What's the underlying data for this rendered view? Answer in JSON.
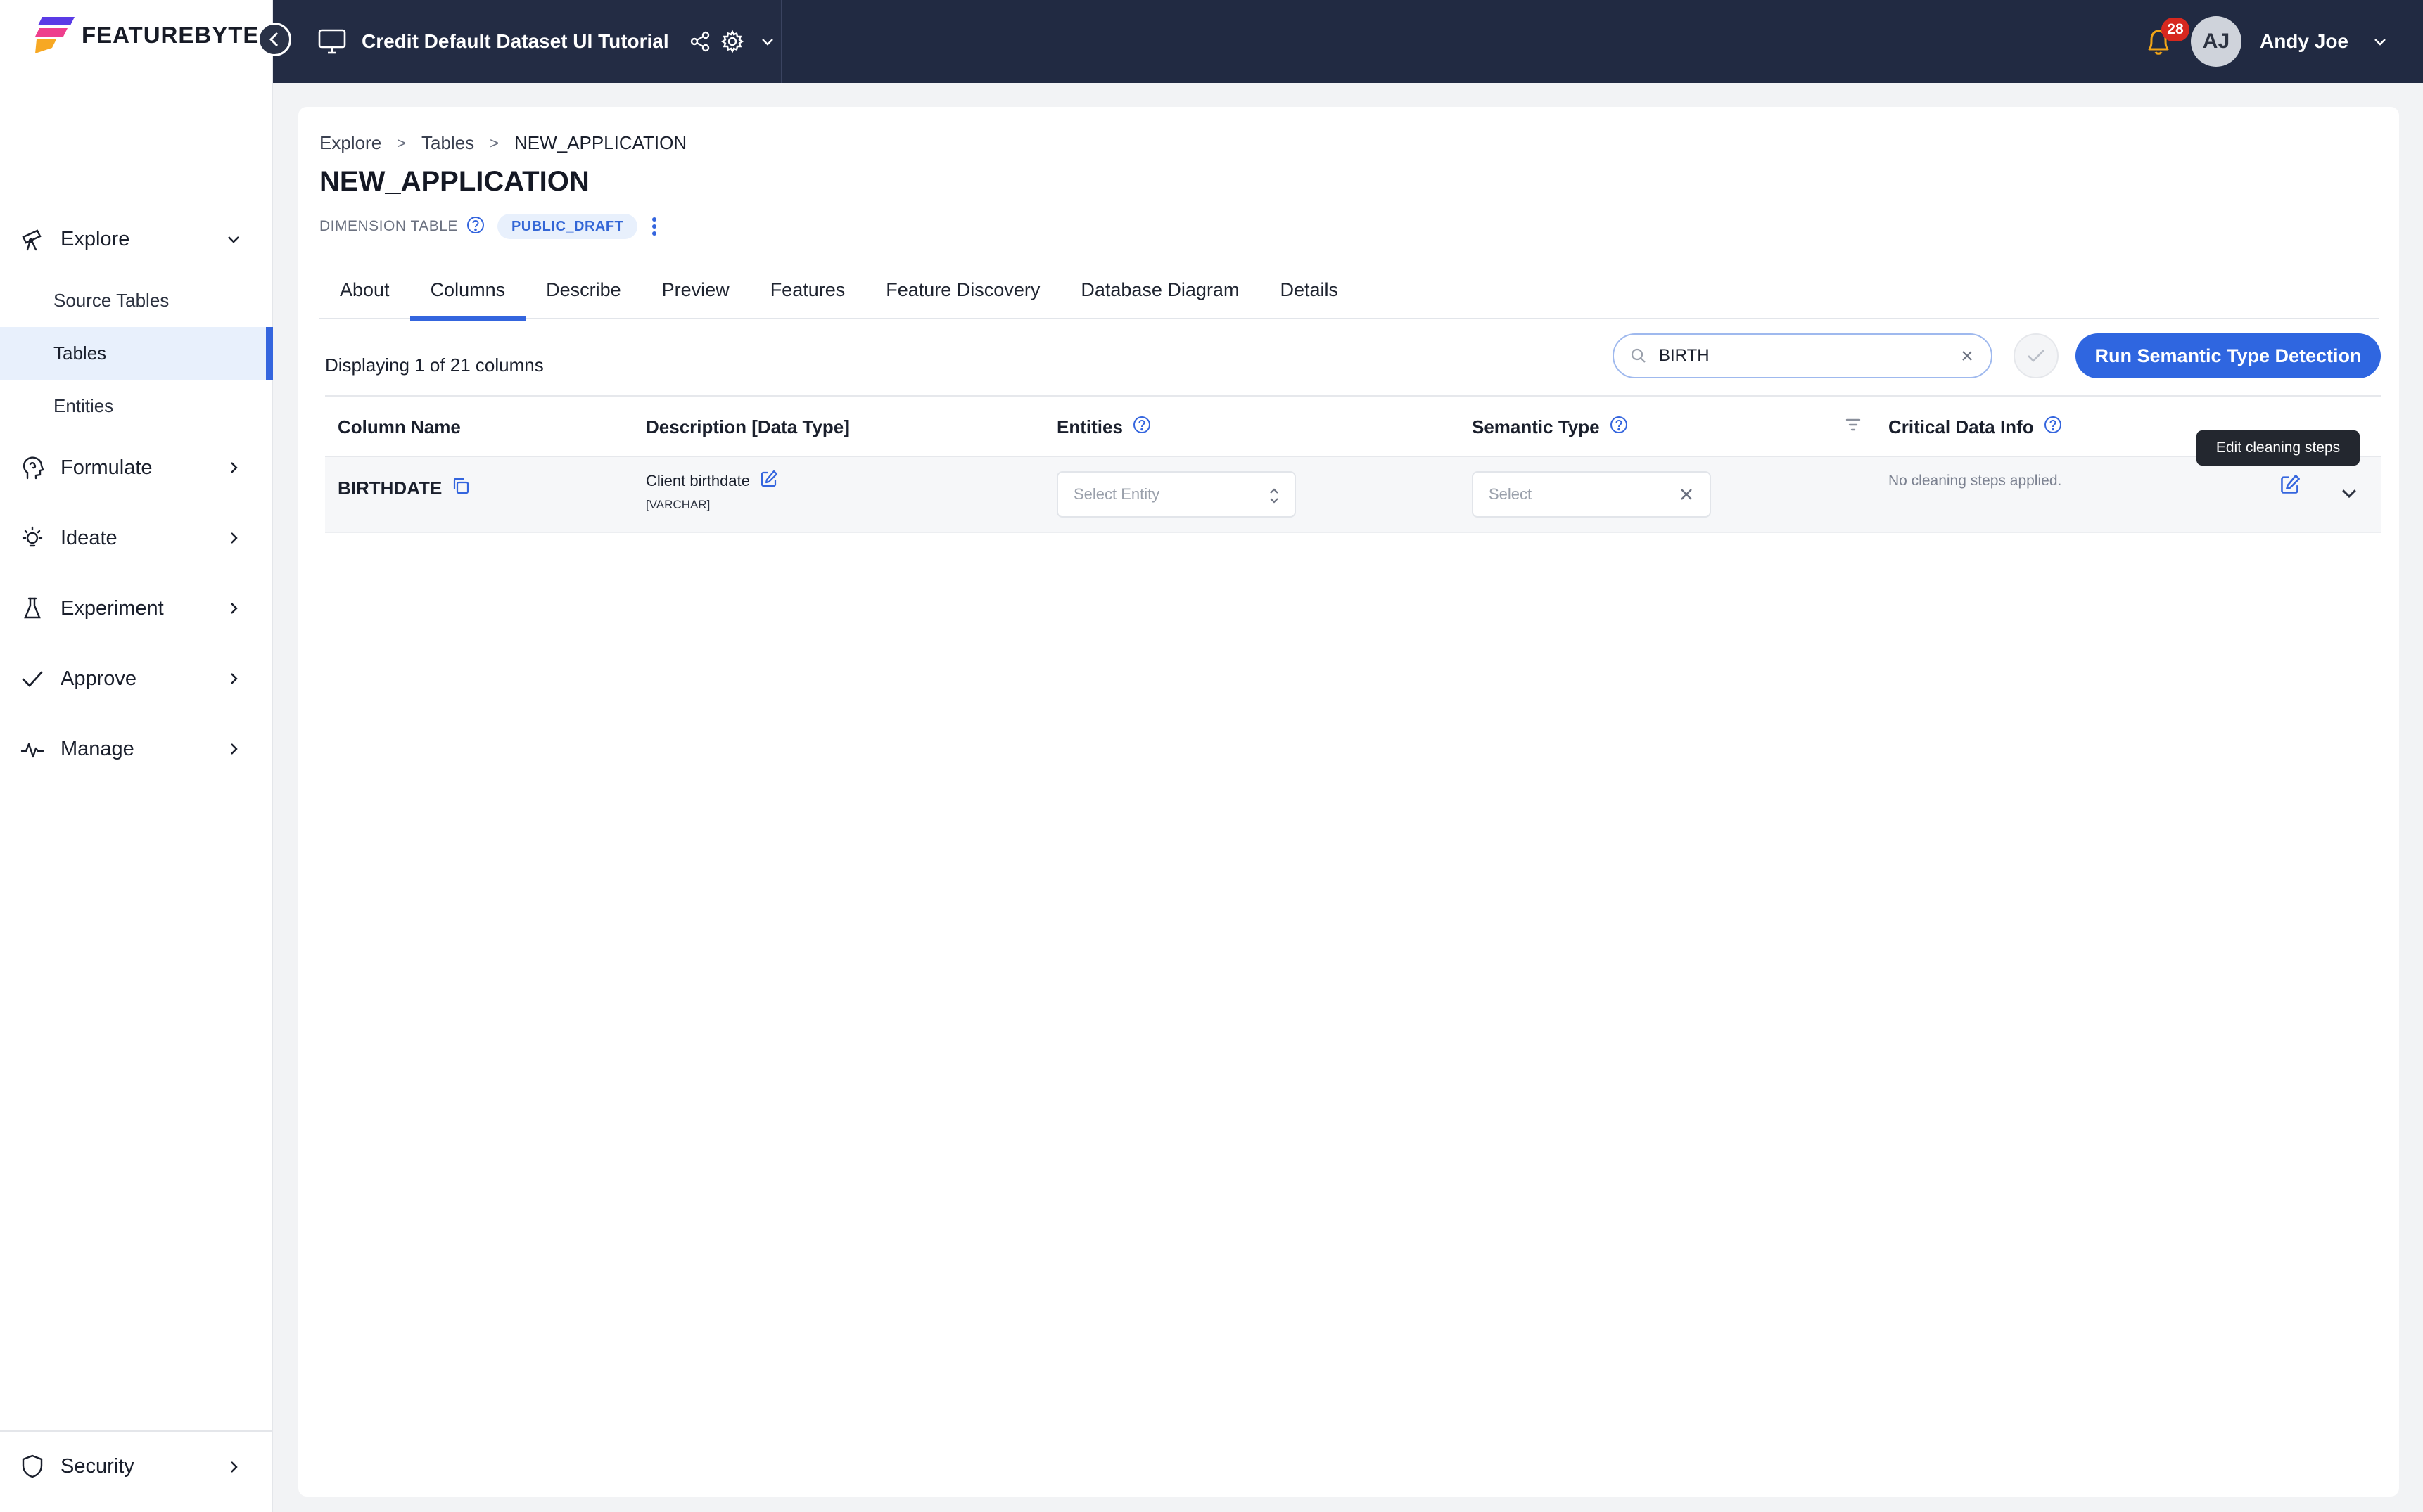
{
  "app": {
    "brand": "FEATUREBYTE",
    "brand_colors": [
      "#5a3be6",
      "#ee3f8d",
      "#f7a823"
    ]
  },
  "topbar": {
    "project_title": "Credit Default Dataset UI Tutorial",
    "notification_count": "28",
    "user_initials": "AJ",
    "user_name": "Andy Joe"
  },
  "sidebar": {
    "items": [
      {
        "label": "Explore",
        "icon": "telescope-icon",
        "expanded": true,
        "children": [
          {
            "label": "Source Tables"
          },
          {
            "label": "Tables",
            "active": true
          },
          {
            "label": "Entities"
          }
        ]
      },
      {
        "label": "Formulate",
        "icon": "head-icon"
      },
      {
        "label": "Ideate",
        "icon": "lightbulb-icon"
      },
      {
        "label": "Experiment",
        "icon": "flask-icon"
      },
      {
        "label": "Approve",
        "icon": "check-icon"
      },
      {
        "label": "Manage",
        "icon": "pulse-icon"
      }
    ],
    "security_label": "Security"
  },
  "breadcrumb": {
    "items": [
      "Explore",
      "Tables",
      "NEW_APPLICATION"
    ]
  },
  "page": {
    "title": "NEW_APPLICATION",
    "table_type": "DIMENSION TABLE",
    "status": "PUBLIC_DRAFT"
  },
  "tabs": [
    "About",
    "Columns",
    "Describe",
    "Preview",
    "Features",
    "Feature Discovery",
    "Database Diagram",
    "Details"
  ],
  "active_tab": "Columns",
  "toolbar": {
    "displaying": "Displaying 1 of 21 columns",
    "search_value": "BIRTH",
    "run_label": "Run Semantic Type Detection"
  },
  "table": {
    "headers": {
      "column_name": "Column Name",
      "description": "Description [Data Type]",
      "entities": "Entities",
      "semantic_type": "Semantic Type",
      "critical": "Critical Data Info"
    },
    "rows": [
      {
        "column_name": "BIRTHDATE",
        "description": "Client birthdate",
        "data_type": "[VARCHAR]",
        "entity_placeholder": "Select Entity",
        "semantic_placeholder": "Select",
        "critical_info": "No cleaning steps applied."
      }
    ]
  },
  "tooltip": "Edit cleaning steps",
  "colors": {
    "accent": "#3465de",
    "topbar": "#212a42",
    "badge": "#d6281f"
  }
}
